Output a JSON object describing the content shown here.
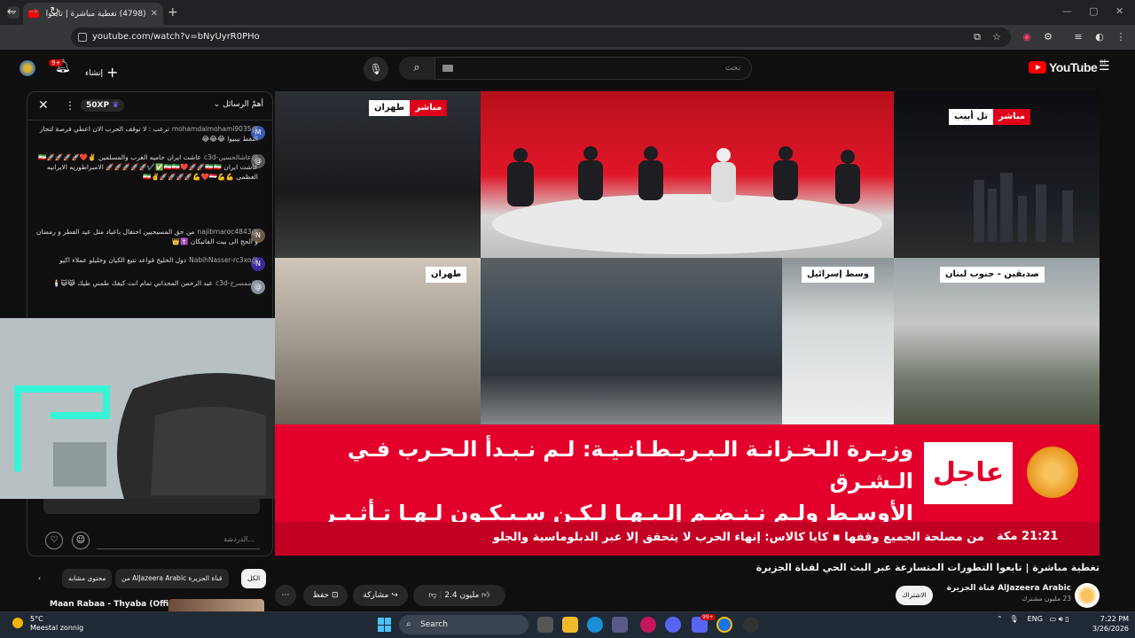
{
  "browser": {
    "tab_title": "(4798) تغطية مباشرة | تابعوا",
    "url": "youtube.com/watch?v=bNyUyrR0PHo"
  },
  "header": {
    "notification_count": "9+",
    "create_label": "إنشاء",
    "search_placeholder": "بحث",
    "logo_text": "YouTube",
    "logo_region": "BE"
  },
  "chat": {
    "xp_label": "50XP",
    "mode_label": "أهمّ الرسائل",
    "messages": [
      {
        "author": "@mohamdalmohami9035",
        "text": "ترعب : لا توقف الحرب الان اعطي فرصة لتجار النفط بيبيوا 😂😂😂",
        "avatar": "M"
      },
      {
        "author": "@عاشالحسين-c3d",
        "text": "عاشت ايران حاميه العرب والمسلمين ✌️❤️🚀🚀🚀🚀🇮🇷 عاشت ايران 🇮🇷🇮🇷❤️🚀🚀🇮🇷🇮🇷✅✔️🚀🚀🚀🚀🚀 الامبراطوريه الايرانيه العظمى 💪💪🇮🇷✌️🚀🚀🚀🚀💪❤️🇪🇬",
        "avatar": "@"
      },
      {
        "author": "@najibmaroc4843",
        "text": "من حق المسيحيين احتفال باعياد مثل عيد الفطر و رمضان و الحج الى بيت الفاتيكان ✝️👑",
        "avatar": "N"
      },
      {
        "author": "@NabihNasser-rc3xo",
        "text": "دول الخليج قواعد تتبع الكيان وخليلو عملاء اكيو",
        "avatar": "N"
      },
      {
        "author": "@ممسرح-c3d",
        "text": "عبد الرحمن المحداني تمام انت كيفك طمني طيك 😹😺🕯️",
        "avatar": "@"
      }
    ],
    "input_placeholder": "الدردشة..."
  },
  "video": {
    "feeds": [
      {
        "label": "طهران",
        "live": "مباشر"
      },
      {
        "label": "تل أبيب",
        "live": "مباشر"
      },
      {
        "label": "طهران",
        "live": ""
      },
      {
        "label": "وسط إسرائيل",
        "live": ""
      },
      {
        "label": "صديقين - جنوب لبنان",
        "live": ""
      }
    ],
    "breaking_label": "عاجل",
    "breaking_line1": "وزيـرة الـخـزانـة الـبـريـطـانـيـة: لـم نـبـدأ الـحـرب فـي الـشـرق",
    "breaking_line2": "الأوسـط ولـم نـنـضـم إلـيـهـا لـكـن سـيـكـون لـهـا تـأثـيـر عـلـى بـلـدنـا",
    "ticker_time": "21:21 مكة",
    "ticker_text": "من مصلحة الجميع وقفها  ▪  كايا كالاس: إنهاء الحرب لا يتحقق إلا عبر الدبلوماسية والجلو"
  },
  "meta": {
    "title": "تغطية مباشرة | تابعوا التطورات المتسارعة عبر البث الحي لقناة الجزيرة",
    "channel": "AlJazeera Arabic قناة الجزيرة",
    "subs": "23 مليون مشترك",
    "subscribe": "الاشتراك",
    "likes": "2.4 مليون",
    "share": "مشاركة",
    "save": "حفظ"
  },
  "related": {
    "chips": [
      "الكل",
      "من AlJazeera Arabic قناة الجزيرة",
      "محتوى مشابه"
    ],
    "first_title": "Maan Rabaa - Thyaba (Official"
  },
  "taskbar": {
    "weather_temp": "5°C",
    "weather_desc": "Meestal zonnig",
    "search": "Search",
    "lang": "ENG",
    "time": "7:22 PM",
    "date": "3/26/2026",
    "discord_badge": "99+"
  },
  "colors": {
    "breaking_red": "#e3002b",
    "live_red": "#e1001a",
    "yt_red": "#ff0000"
  }
}
